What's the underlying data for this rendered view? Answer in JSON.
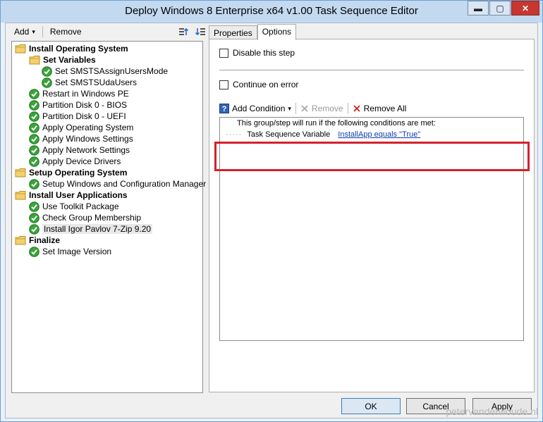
{
  "window": {
    "title": "Deploy Windows 8 Enterprise x64 v1.00 Task Sequence Editor",
    "minimize": "▬",
    "maximize": "▢",
    "close": "✕"
  },
  "toolbar": {
    "add_label": "Add",
    "add_caret": "▾",
    "remove_label": "Remove"
  },
  "tree": [
    {
      "label": "Install Operating System",
      "type": "group",
      "level": 0
    },
    {
      "label": "Set Variables",
      "type": "group",
      "level": 1
    },
    {
      "label": "Set SMSTSAssignUsersMode",
      "type": "step",
      "level": 2
    },
    {
      "label": "Set SMSTSUdaUsers",
      "type": "step",
      "level": 2
    },
    {
      "label": "Restart in Windows PE",
      "type": "step",
      "level": 1
    },
    {
      "label": "Partition Disk 0 - BIOS",
      "type": "step",
      "level": 1
    },
    {
      "label": "Partition Disk 0 - UEFI",
      "type": "step",
      "level": 1
    },
    {
      "label": "Apply Operating System",
      "type": "step",
      "level": 1
    },
    {
      "label": "Apply Windows Settings",
      "type": "step",
      "level": 1
    },
    {
      "label": "Apply Network Settings",
      "type": "step",
      "level": 1
    },
    {
      "label": "Apply Device Drivers",
      "type": "step",
      "level": 1
    },
    {
      "label": "Setup Operating System",
      "type": "group",
      "level": 0
    },
    {
      "label": "Setup Windows and Configuration Manager",
      "type": "step",
      "level": 1
    },
    {
      "label": "Install User Applications",
      "type": "group",
      "level": 0
    },
    {
      "label": "Use Toolkit Package",
      "type": "step",
      "level": 1
    },
    {
      "label": "Check Group Membership",
      "type": "step",
      "level": 1
    },
    {
      "label": "Install Igor Pavlov 7-Zip 9.20",
      "type": "step",
      "level": 1,
      "selected": true
    },
    {
      "label": "Finalize",
      "type": "group",
      "level": 0
    },
    {
      "label": "Set Image Version",
      "type": "step",
      "level": 1
    }
  ],
  "tabs": [
    {
      "label": "Properties",
      "active": false
    },
    {
      "label": "Options",
      "active": true
    }
  ],
  "options": {
    "disable_step_label": "Disable this step",
    "continue_on_error_label": "Continue on error"
  },
  "conditions": {
    "add_condition_label": "Add Condition",
    "add_condition_caret": "▾",
    "remove_label": "Remove",
    "remove_all_label": "Remove All",
    "header_text": "This group/step will run if the following conditions are met:",
    "item_dots": "·····",
    "item_type": "Task Sequence Variable",
    "item_link": "InstallApp equals \"True\""
  },
  "buttons": {
    "ok": "OK",
    "cancel": "Cancel",
    "apply": "Apply"
  },
  "watermark": "petervanderwoude.nl",
  "colors": {
    "highlight_border": "#d4212c",
    "link": "#0b3eaa",
    "check_green": "#2e9e2e",
    "folder_yellow": "#e8c24a"
  }
}
